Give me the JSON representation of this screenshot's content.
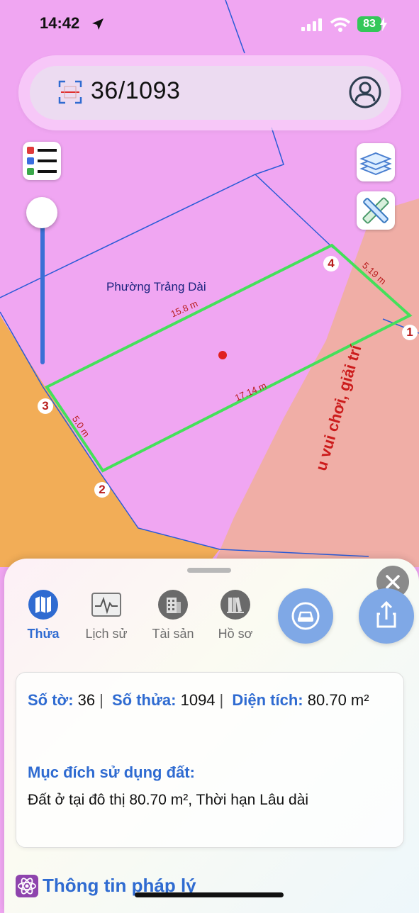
{
  "status_bar": {
    "time": "14:42",
    "battery": "83"
  },
  "search": {
    "query": "36/1093"
  },
  "map": {
    "ward_label": "Phường Trảng Dài",
    "edges": [
      "15.8 m",
      "5.19 m",
      "17.14 m",
      "5.0 m"
    ],
    "points": [
      "1",
      "2",
      "3",
      "4"
    ],
    "vertical_text": "u vui chơi, giải trí",
    "colors": {
      "parcel": "#f0a6f2",
      "outline": "#44e05a",
      "orange_zone": "#f2ad57",
      "salmon_zone": "#f0aea6",
      "boundary": "#2a5bd7"
    }
  },
  "sheet": {
    "tabs": [
      {
        "label": "Thửa",
        "icon": "map-icon",
        "active": true
      },
      {
        "label": "Lịch sử",
        "icon": "history-chart-icon",
        "active": false
      },
      {
        "label": "Tài sản",
        "icon": "building-icon",
        "active": false
      },
      {
        "label": "Hồ sơ",
        "icon": "books-icon",
        "active": false
      }
    ],
    "info": {
      "so_to_label": "Số tờ:",
      "so_to": "36",
      "so_thua_label": "Số thửa:",
      "so_thua": "1094",
      "dien_tich_label": "Diện tích:",
      "dien_tich": "80.70 m²",
      "purpose_title": "Mục đích sử dụng đất:",
      "purpose": "Đất ở tại đô thị 80.70 m², Thời hạn Lâu dài"
    },
    "legal_title": "Thông tin pháp lý",
    "accent_color": "#2f6bd1"
  }
}
